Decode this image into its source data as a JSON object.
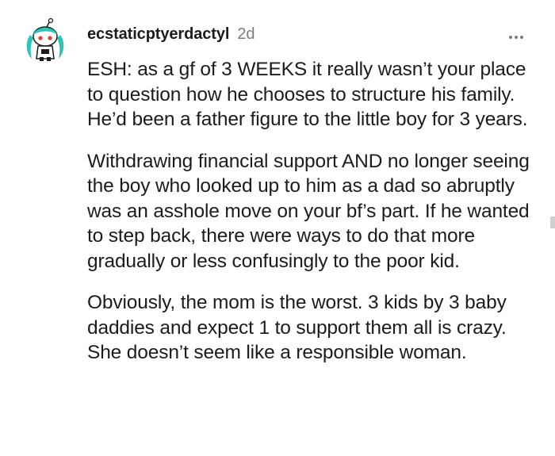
{
  "comment": {
    "username": "ecstaticptyerdactyl",
    "age": "2d",
    "avatar_icon": "snoo-avatar-icon",
    "more_icon": "more-options-icon",
    "paragraphs": [
      "ESH: as a gf of 3 WEEKS it really wasn’t your place to question how he chooses to structure his family. He’d been a father figure to the little boy for 3 years.",
      "Withdrawing financial support AND no longer seeing the boy who looked up to him as a dad so abruptly was an asshole move on your bf’s part. If he wanted to step back, there were ways to do that more gradually or less confusingly to the poor kid.",
      "Obviously, the mom is the worst. 3 kids by 3 baby daddies and expect 1 to support them all is crazy. She doesn’t seem like a responsible woman."
    ]
  },
  "colors": {
    "avatar_hair": "#2ec4b6",
    "avatar_eye": "#e8402a",
    "text": "#1c1c1c",
    "muted": "#7c7c7c"
  }
}
